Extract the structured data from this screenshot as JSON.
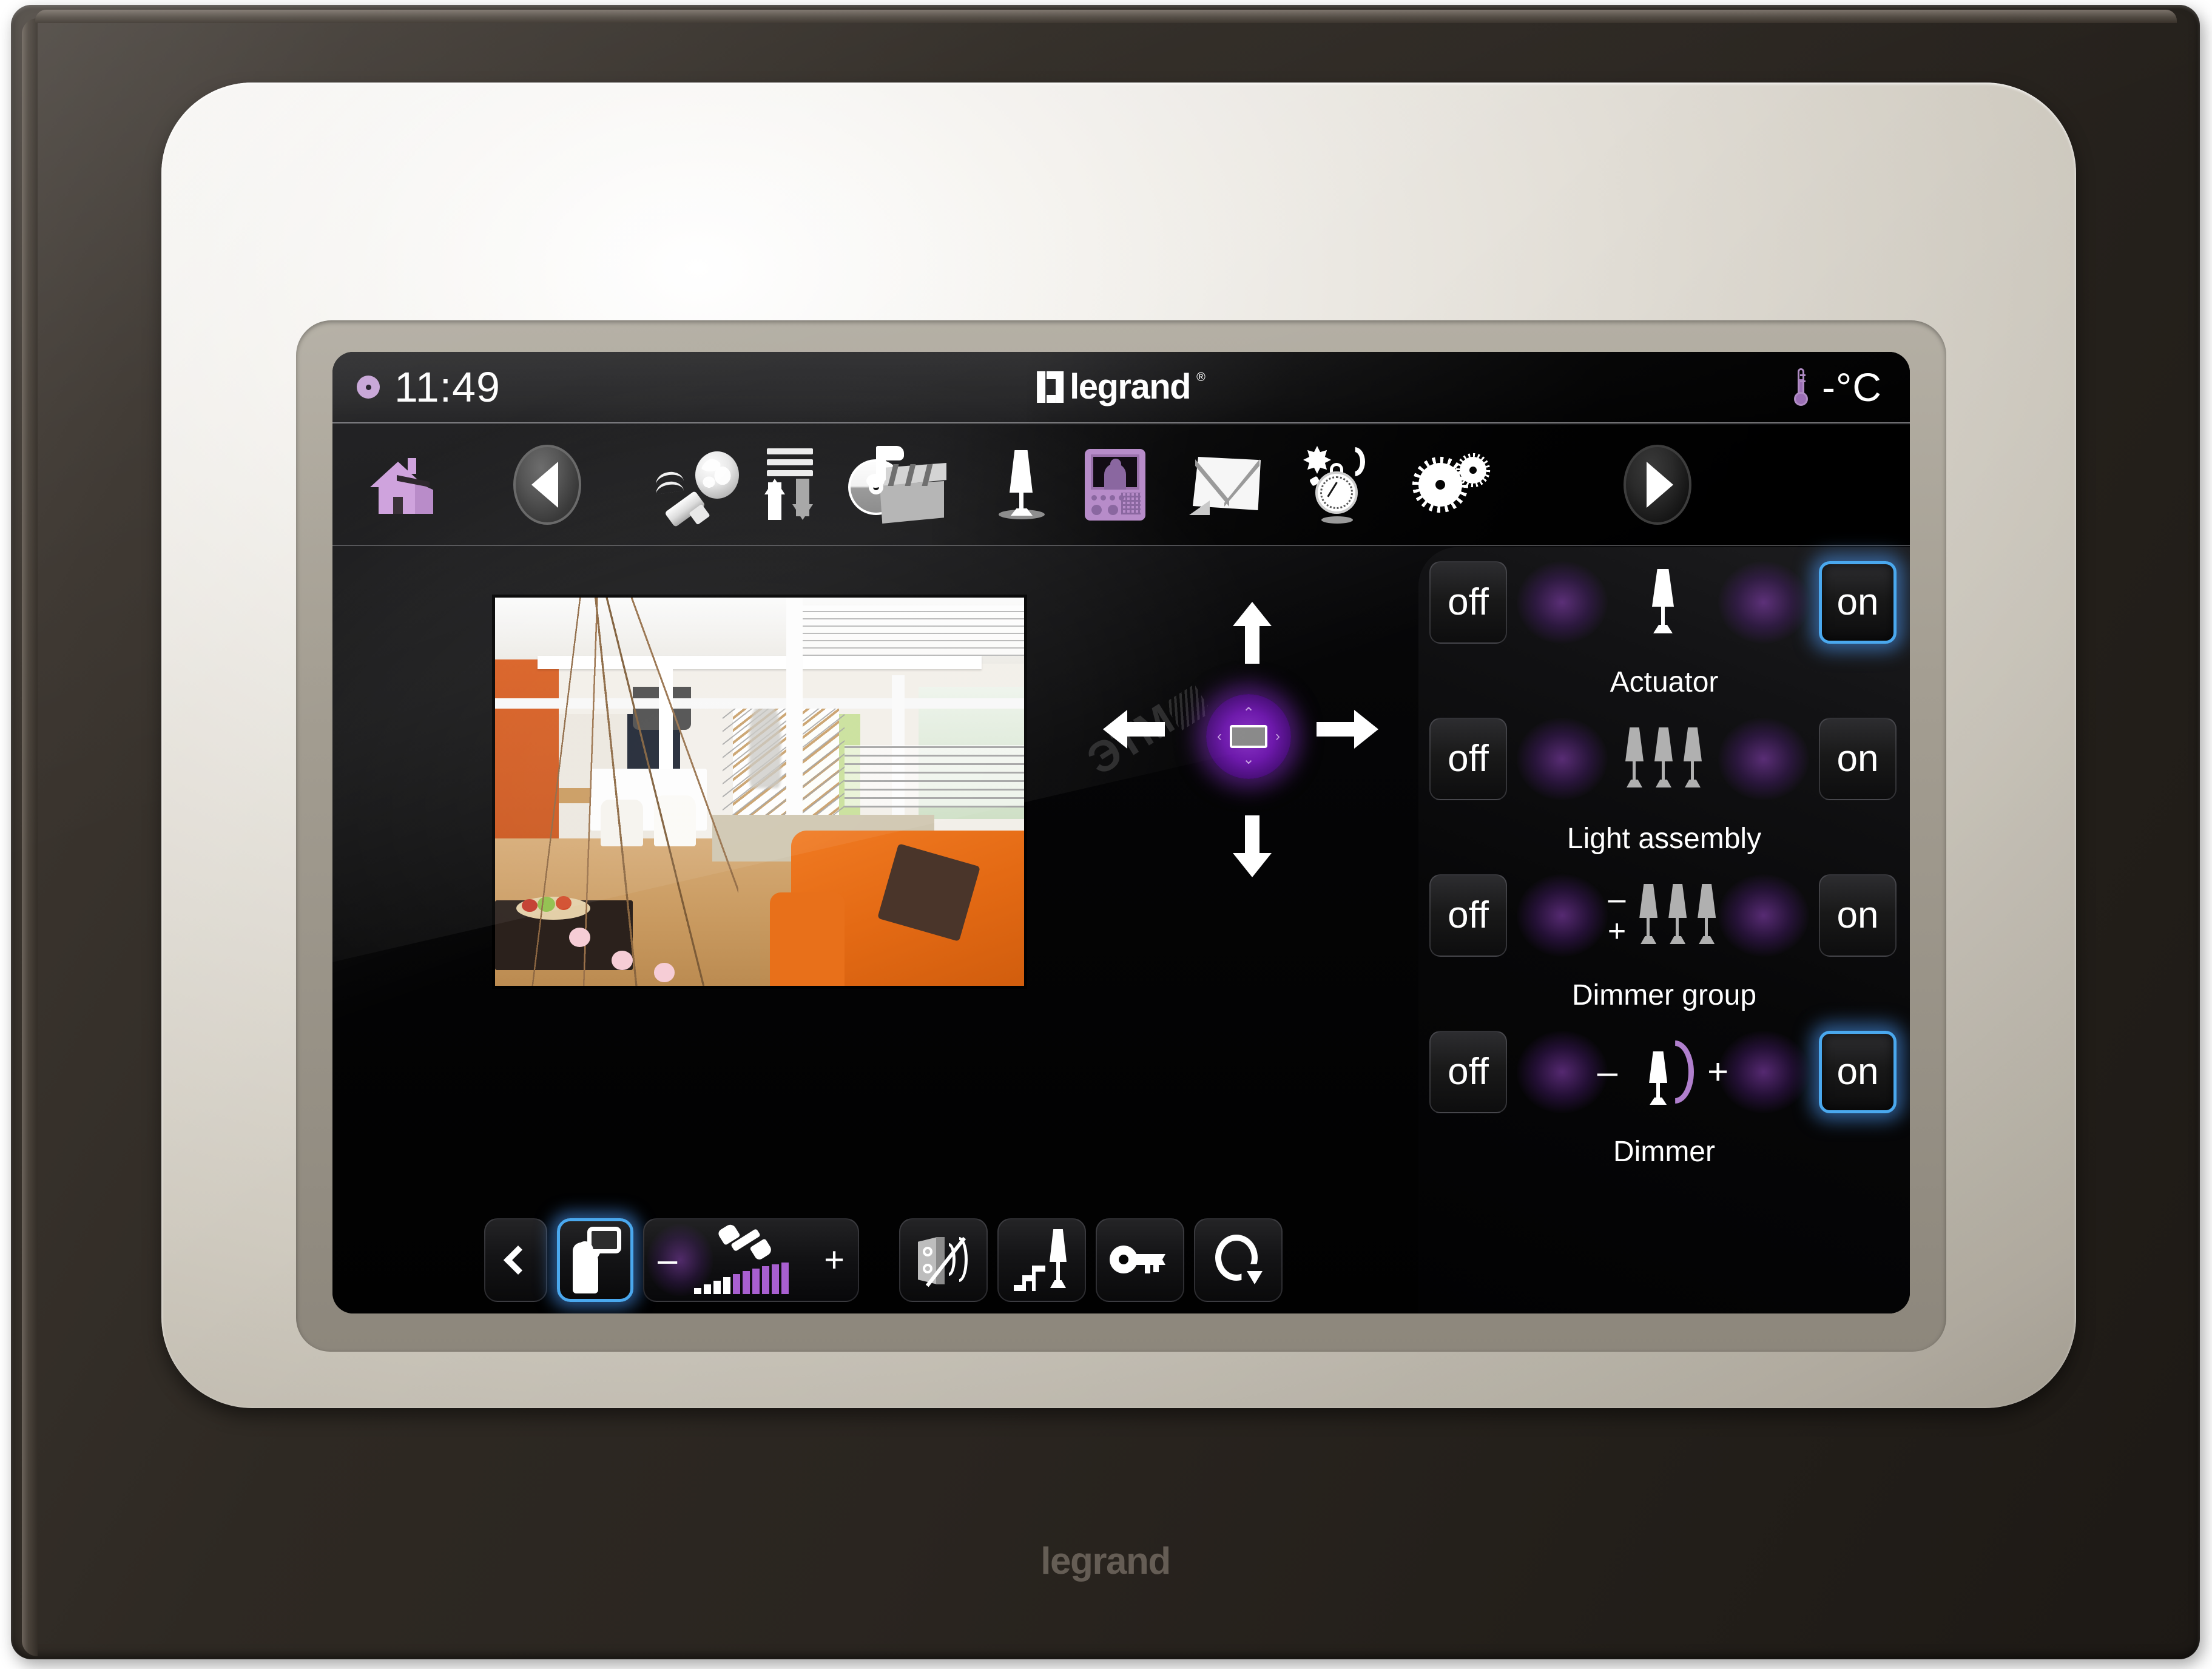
{
  "device": {
    "brand_bottom": "legrand",
    "bezel_color": "#d9d4ca",
    "body_color": "#2b2620"
  },
  "status_bar": {
    "clock": "11:49",
    "brand": "legrand",
    "brand_registered": "®",
    "temperature": "-°C",
    "thermometer_icon": "thermometer-icon",
    "clock_dot_color": "#c9a8d8"
  },
  "nav_bar": {
    "items": [
      {
        "name": "home",
        "icon": "home-icon"
      },
      {
        "name": "previous",
        "icon": "previous-arrow-icon"
      },
      {
        "name": "web-usb",
        "icon": "globe-usb-icon"
      },
      {
        "name": "updown",
        "icon": "up-down-arrows-icon"
      },
      {
        "name": "multimedia",
        "icon": "cd-clapperboard-icon"
      },
      {
        "name": "lighting",
        "icon": "lamp-icon"
      },
      {
        "name": "video-station",
        "icon": "video-door-station-icon"
      },
      {
        "name": "messages",
        "icon": "envelope-icon"
      },
      {
        "name": "scenarios",
        "icon": "sun-moon-stopwatch-icon"
      },
      {
        "name": "settings",
        "icon": "gears-icon"
      },
      {
        "name": "next",
        "icon": "next-arrow-icon"
      }
    ]
  },
  "camera": {
    "label": "door-camera-preview"
  },
  "dpad": {
    "up": "▲",
    "down": "▼",
    "left": "◀",
    "right": "▶",
    "center_icon": "screen-pan-icon",
    "center_up": "⌃",
    "center_down": "⌄",
    "center_left": "‹",
    "center_right": "›"
  },
  "watermark": {
    "text": "ЭТМ"
  },
  "controls": {
    "off_label": "off",
    "on_label": "on",
    "minus_label": "–",
    "plus_label": "+",
    "rows": [
      {
        "label": "Actuator",
        "icon": "single-lamp-icon",
        "state": "on",
        "off_lit": false,
        "on_lit": true,
        "has_dim": false
      },
      {
        "label": "Light assembly",
        "icon": "three-lamps-icon",
        "state": "off",
        "off_lit": false,
        "on_lit": false,
        "has_dim": false
      },
      {
        "label": "Dimmer group",
        "icon": "three-lamps-dim-icon",
        "state": "off",
        "off_lit": false,
        "on_lit": false,
        "has_dim": true
      },
      {
        "label": "Dimmer",
        "icon": "dimmer-arc-lamp-icon",
        "state": "on",
        "off_lit": false,
        "on_lit": true,
        "has_dim": true
      }
    ],
    "highlight_color": "#4aa8ee",
    "glow_color": "#9646c8"
  },
  "bottom_bar": {
    "items": [
      {
        "name": "back",
        "icon": "chevron-left-icon",
        "lit": false
      },
      {
        "name": "talk",
        "icon": "person-speech-icon",
        "lit": true
      },
      {
        "name": "volume",
        "icon": "handset-volume-icon",
        "lit": false
      },
      {
        "name": "mute-speaker",
        "icon": "speaker-muted-icon",
        "lit": false
      },
      {
        "name": "staircase-light",
        "icon": "stair-light-icon",
        "lit": false
      },
      {
        "name": "door-lock",
        "icon": "key-icon",
        "lit": false
      },
      {
        "name": "cycle",
        "icon": "loop-arrow-icon",
        "lit": false
      }
    ],
    "volume": {
      "minus": "–",
      "plus": "+",
      "level_bars_total": 10,
      "level_bars_on": 6
    }
  }
}
